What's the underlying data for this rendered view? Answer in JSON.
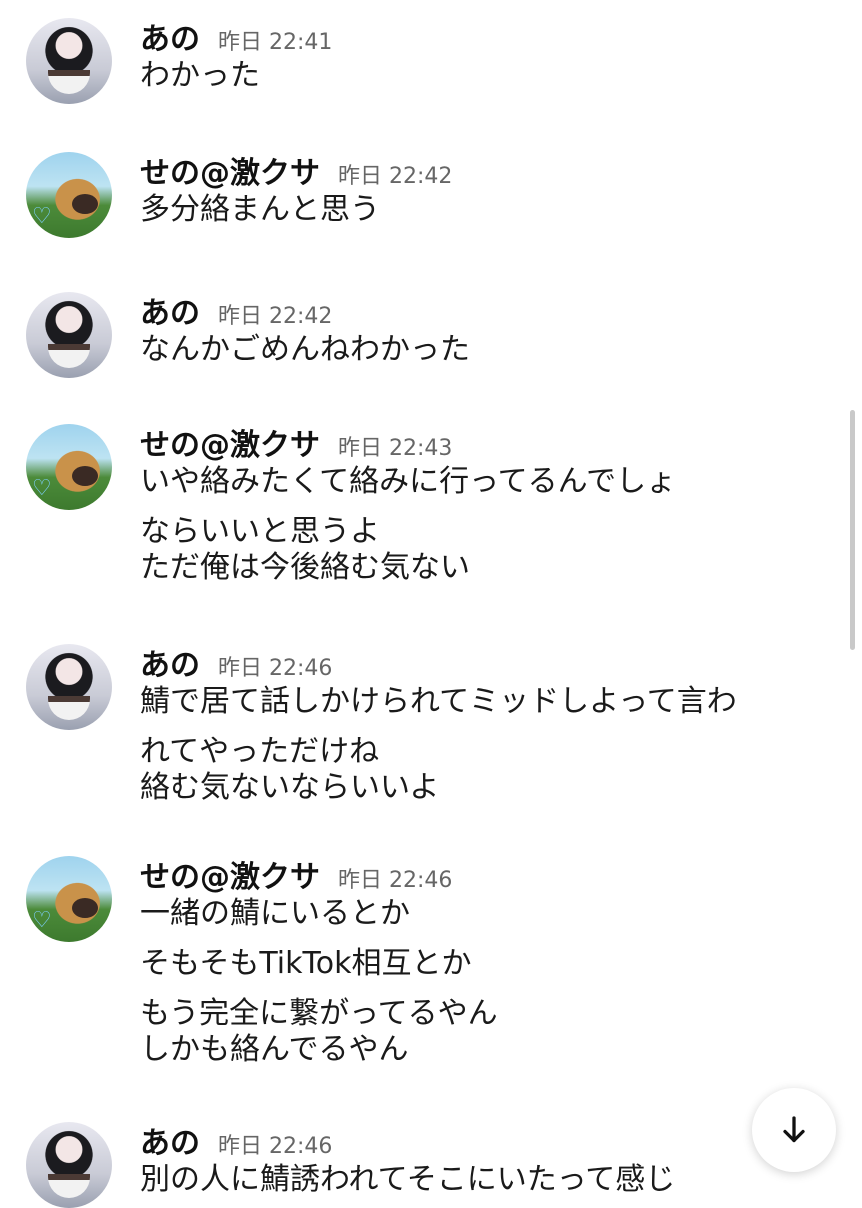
{
  "messages": [
    {
      "user": "あの",
      "avatar": "user-avatar-ano",
      "time": "昨日 22:41",
      "lines": [
        "わかった"
      ]
    },
    {
      "user": "せの@激クサ",
      "avatar": "user-avatar-seno",
      "time": "昨日 22:42",
      "lines": [
        "多分絡まんと思う"
      ]
    },
    {
      "user": "あの",
      "avatar": "user-avatar-ano",
      "time": "昨日 22:42",
      "lines": [
        "なんかごめんねわかった"
      ]
    },
    {
      "user": "せの@激クサ",
      "avatar": "user-avatar-seno",
      "time": "昨日 22:43",
      "lines": [
        "いや絡みたくて絡みに行ってるんでしょ",
        "ならいいと思うよ",
        "ただ俺は今後絡む気ない"
      ]
    },
    {
      "user": "あの",
      "avatar": "user-avatar-ano",
      "time": "昨日 22:46",
      "lines": [
        "鯖で居て話しかけられてミッドしよって言わ",
        "れてやっただけね",
        "絡む気ないならいいよ"
      ]
    },
    {
      "user": "せの@激クサ",
      "avatar": "user-avatar-seno",
      "time": "昨日 22:46",
      "lines": [
        "一緒の鯖にいるとか",
        "そもそもTikTok相互とか",
        "もう完全に繋がってるやん",
        "しかも絡んでるやん"
      ]
    },
    {
      "user": "あの",
      "avatar": "user-avatar-ano",
      "time": "昨日 22:46",
      "lines": [
        "別の人に鯖誘われてそこにいたって感じ"
      ]
    }
  ],
  "scroll_to_bottom_icon": "arrow-down-icon",
  "colors": {
    "name": "#111111",
    "text": "#1a1a1a",
    "time": "#666666",
    "background": "#ffffff"
  }
}
